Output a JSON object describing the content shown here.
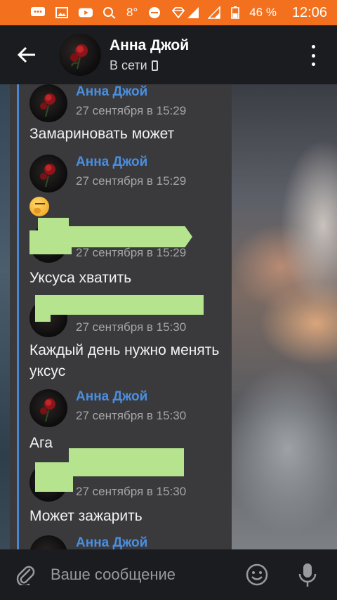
{
  "status_bar": {
    "temperature": "8°",
    "battery_percent": "46 %",
    "time": "12:06",
    "background_color": "#f3701e"
  },
  "header": {
    "contact_name": "Анна Джой",
    "status": "В сети"
  },
  "messages": [
    {
      "sender": "Анна Джой",
      "time": "27 сентября в 15:29",
      "text": "Замариновать может"
    },
    {
      "sender": "Анна Джой",
      "time": "27 сентября в 15:29",
      "text": "🤔"
    },
    {
      "sender": "",
      "time": "27 сентября в 15:29",
      "text": "Уксуса хватить"
    },
    {
      "sender": "",
      "time": "27 сентября в 15:30",
      "text": "Каждый день нужно менять уксус"
    },
    {
      "sender": "Анна Джой",
      "time": "27 сентября в 15:30",
      "text": "Ага"
    },
    {
      "sender": "",
      "time": "27 сентября в 15:30",
      "text": "Может зажарить"
    },
    {
      "sender": "Анна Джой",
      "time": "",
      "text": ""
    }
  ],
  "input": {
    "placeholder": "Ваше сообщение"
  },
  "colors": {
    "accent_name": "#4a8ee0",
    "redaction": "#b6e38e"
  }
}
